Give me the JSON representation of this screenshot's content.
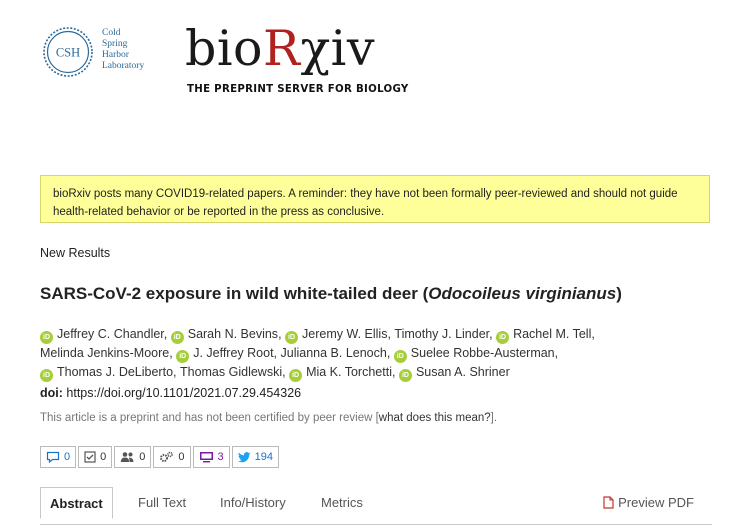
{
  "header": {
    "cshl_seal": "CSH",
    "cshl_lines": [
      "Cold",
      "Spring",
      "Harbor",
      "Laboratory"
    ],
    "logo_prefix": "bio",
    "logo_r": "R",
    "logo_suffix": "χiv",
    "tagline": "THE PREPRINT SERVER FOR BIOLOGY",
    "brand_color": "#b0211f"
  },
  "notice": {
    "text": "bioRxiv posts many COVID19-related papers. A reminder: they have not been formally peer-reviewed and should not guide health-related behavior or be reported in the press as conclusive."
  },
  "article": {
    "section": "New Results",
    "title_prefix": "SARS-CoV-2 exposure in wild white-tailed deer (",
    "title_species": "Odocoileus virginianus",
    "title_suffix": ")",
    "authors": [
      {
        "name": "Jeffrey C. Chandler",
        "orcid": true,
        "sep": ", "
      },
      {
        "name": "Sarah N. Bevins",
        "orcid": true,
        "sep": ", "
      },
      {
        "name": "Jeremy W. Ellis",
        "orcid": true,
        "sep": ", "
      },
      {
        "name": "Timothy J. Linder",
        "orcid": false,
        "sep": ", "
      },
      {
        "name": "Rachel M. Tell",
        "orcid": true,
        "sep": ", "
      },
      {
        "name": "Melinda Jenkins-Moore",
        "orcid": false,
        "sep": ", "
      },
      {
        "name": "J. Jeffrey Root",
        "orcid": true,
        "sep": ", "
      },
      {
        "name": "Julianna B. Lenoch",
        "orcid": false,
        "sep": ", "
      },
      {
        "name": "Suelee Robbe-Austerman",
        "orcid": true,
        "sep": ", "
      },
      {
        "name": "Thomas J. DeLiberto",
        "orcid": true,
        "sep": ", "
      },
      {
        "name": "Thomas Gidlewski",
        "orcid": false,
        "sep": ", "
      },
      {
        "name": "Mia K. Torchetti",
        "orcid": true,
        "sep": ", "
      },
      {
        "name": "Susan A. Shriner",
        "orcid": true,
        "sep": ""
      }
    ],
    "orcid_badge": "iD",
    "doi_label": "doi:",
    "doi_value": "https://doi.org/10.1101/2021.07.29.454326",
    "cert_text": "This article is a preprint and has not been certified by peer review [",
    "cert_link": "what does this mean?",
    "cert_end": "]."
  },
  "metrics": [
    {
      "icon": "comment-icon",
      "value": "0"
    },
    {
      "icon": "check-square-icon",
      "value": "0"
    },
    {
      "icon": "users-icon",
      "value": "0"
    },
    {
      "icon": "gears-icon",
      "value": "0"
    },
    {
      "icon": "monitor-icon",
      "value": "3"
    },
    {
      "icon": "twitter-icon",
      "value": "194"
    }
  ],
  "tabs": {
    "abstract": "Abstract",
    "full_text": "Full Text",
    "info": "Info/History",
    "metrics": "Metrics",
    "preview_pdf": "Preview PDF"
  }
}
